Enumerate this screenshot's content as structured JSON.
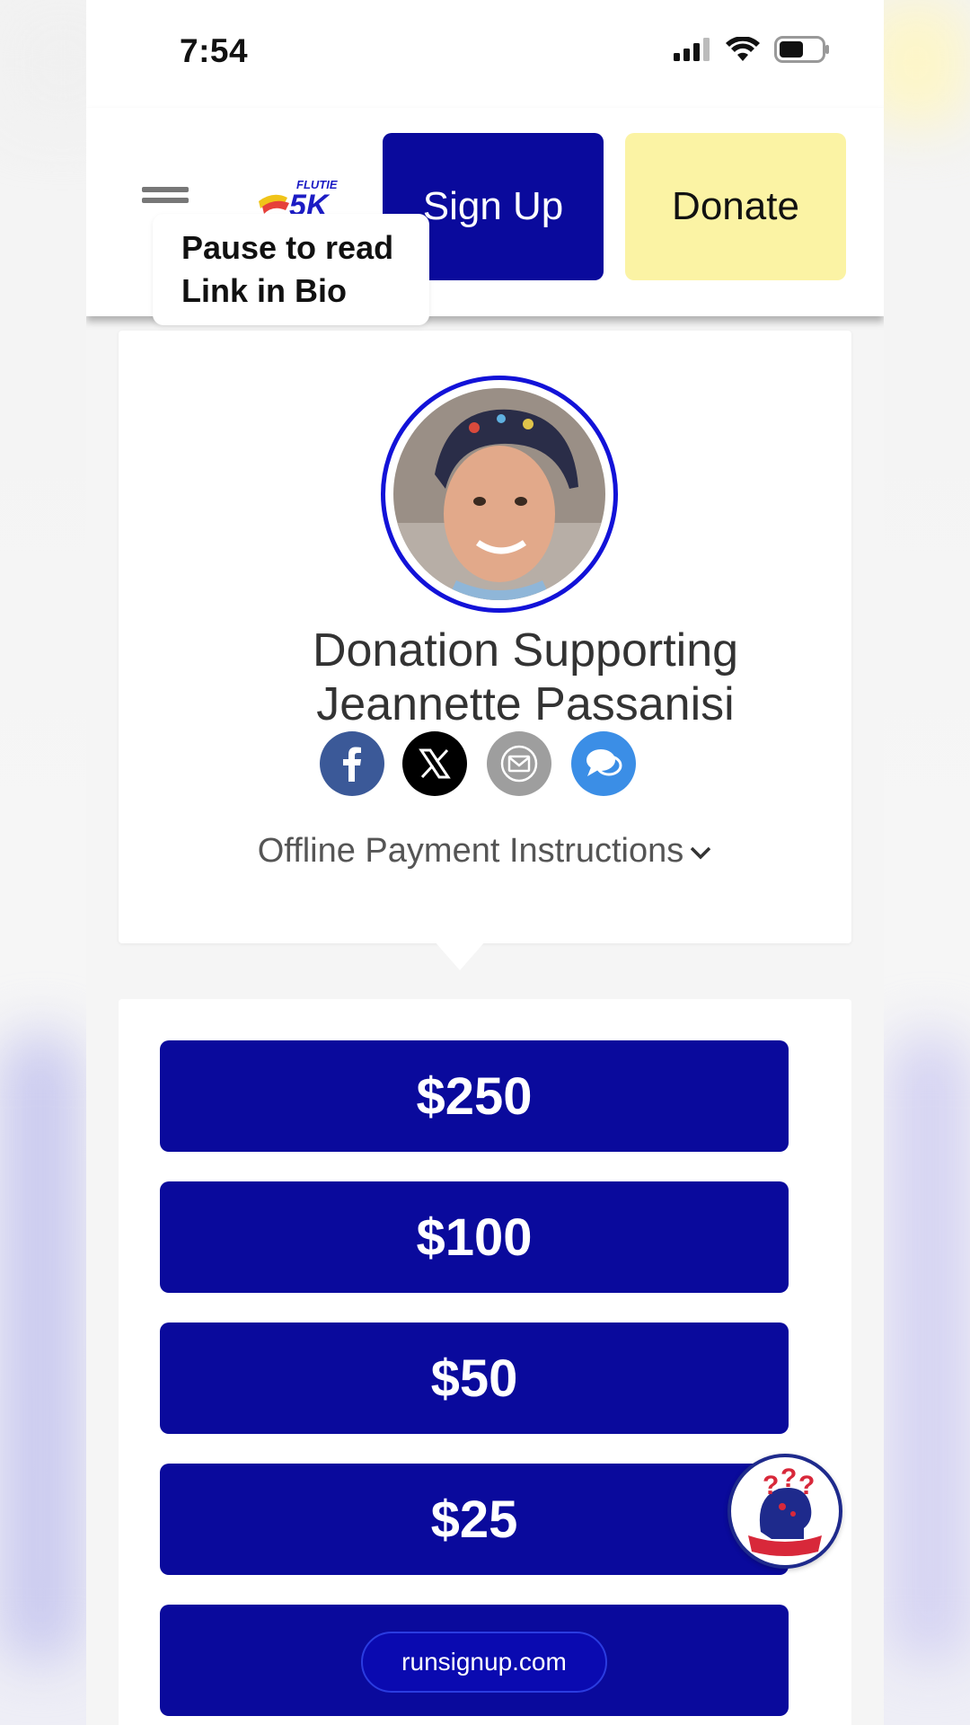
{
  "status_bar": {
    "time": "7:54"
  },
  "header": {
    "signup_label": "Sign Up",
    "donate_label": "Donate"
  },
  "caption": {
    "line1": "Pause to read",
    "line2": "Link in Bio"
  },
  "profile": {
    "title_line1": "Donation Supporting",
    "title_line2": "Jeannette Passanisi",
    "share_icons": [
      "facebook-icon",
      "x-icon",
      "email-icon",
      "chat-icon"
    ],
    "offline_label": "Offline Payment Instructions"
  },
  "amounts": [
    "$250",
    "$100",
    "$50",
    "$25",
    ""
  ],
  "url_bar": {
    "label": "runsignup.com"
  },
  "colors": {
    "primary": "#0a0a9c",
    "donate": "#fbf3a4",
    "ring": "#1212d8",
    "facebook": "#3b5998",
    "x": "#000000",
    "email": "#9e9e9e",
    "chat": "#3b8ee6"
  }
}
